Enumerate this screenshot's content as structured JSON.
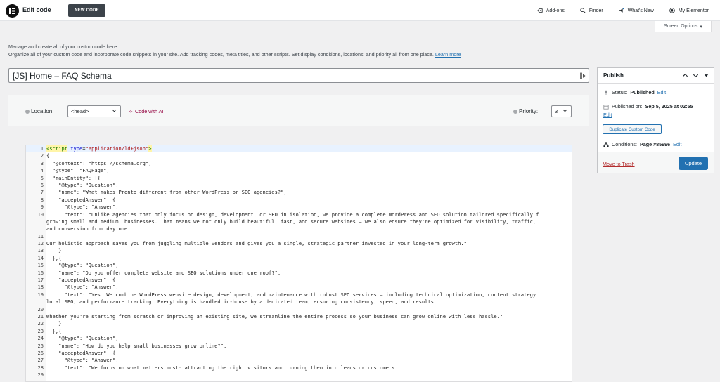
{
  "topbar": {
    "app_title": "Edit code",
    "new_code_label": "NEW CODE",
    "nav": {
      "addons": "Add-ons",
      "finder": "Finder",
      "whats_new": "What's New",
      "my_elementor": "My Elementor"
    }
  },
  "screen_options": "Screen Options",
  "intro": {
    "line1": "Manage and create all of your custom code here.",
    "line2": "Organize all of your custom code and incorporate code snippets in your site. Add tracking codes, meta titles, and other scripts. Set display conditions, locations, and priority all from one place.",
    "learn_more": "Learn more"
  },
  "code_title": "[JS] Home – FAQ Schema",
  "toolbar": {
    "location_label": "Location:",
    "location_value": "<head>",
    "ai_link": "Code with AI",
    "priority_label": "Priority:",
    "priority_value": "3"
  },
  "publish": {
    "title": "Publish",
    "status_label": "Status:",
    "status_value": "Published",
    "status_edit": "Edit",
    "published_label": "Published on:",
    "published_value": "Sep 5, 2025 at 02:55",
    "published_edit": "Edit",
    "duplicate_label": "Duplicate Custom Code",
    "conditions_label": "Conditions:",
    "conditions_value": "Page #85996",
    "conditions_edit": "Edit",
    "trash_label": "Move to Trash",
    "update_label": "Update"
  },
  "code_lines": [
    {
      "n": "1",
      "t": "<script type=\"application/ld+json\">"
    },
    {
      "n": "2",
      "t": "{"
    },
    {
      "n": "3",
      "t": "  \"@context\": \"https://schema.org\","
    },
    {
      "n": "4",
      "t": "  \"@type\": \"FAQPage\","
    },
    {
      "n": "5",
      "t": "  \"mainEntity\": [{"
    },
    {
      "n": "6",
      "t": "    \"@type\": \"Question\","
    },
    {
      "n": "7",
      "t": "    \"name\": \"What makes Pronto different from other WordPress or SEO agencies?\","
    },
    {
      "n": "8",
      "t": "    \"acceptedAnswer\": {"
    },
    {
      "n": "9",
      "t": "      \"@type\": \"Answer\","
    },
    {
      "n": "10",
      "t": "      \"text\": \"Unlike agencies that only focus on design, development, or SEO in isolation, we provide a complete WordPress and SEO solution tailored specifically f"
    },
    {
      "n": "",
      "t": "growing small and medium  businesses. That means we not only build beautiful, fast, and secure websites — we also ensure they're optimized for visibility, traffic,"
    },
    {
      "n": "",
      "t": "and conversion from day one."
    },
    {
      "n": "11",
      "t": ""
    },
    {
      "n": "12",
      "t": "Our holistic approach saves you from juggling multiple vendors and gives you a single, strategic partner invested in your long-term growth.\""
    },
    {
      "n": "13",
      "t": "    }"
    },
    {
      "n": "14",
      "t": "  },{"
    },
    {
      "n": "15",
      "t": "    \"@type\": \"Question\","
    },
    {
      "n": "16",
      "t": "    \"name\": \"Do you offer complete website and SEO solutions under one roof?\","
    },
    {
      "n": "17",
      "t": "    \"acceptedAnswer\": {"
    },
    {
      "n": "18",
      "t": "      \"@type\": \"Answer\","
    },
    {
      "n": "19",
      "t": "      \"text\": \"Yes. We combine WordPress website design, development, and maintenance with robust SEO services — including technical optimization, content strategy"
    },
    {
      "n": "",
      "t": "local SEO, and performance tracking. Everything is handled in-house by a dedicated team, ensuring consistency, speed, and results."
    },
    {
      "n": "20",
      "t": ""
    },
    {
      "n": "21",
      "t": "Whether you're starting from scratch or improving an existing site, we streamline the entire process so your business can grow online with less hassle.\""
    },
    {
      "n": "22",
      "t": "    }"
    },
    {
      "n": "23",
      "t": "  },{"
    },
    {
      "n": "24",
      "t": "    \"@type\": \"Question\","
    },
    {
      "n": "25",
      "t": "    \"name\": \"How do you help small businesses grow online?\","
    },
    {
      "n": "26",
      "t": "    \"acceptedAnswer\": {"
    },
    {
      "n": "27",
      "t": "      \"@type\": \"Answer\","
    },
    {
      "n": "28",
      "t": "      \"text\": \"We focus on what matters most: attracting the right visitors and turning them into leads or customers."
    },
    {
      "n": "29",
      "t": ""
    }
  ]
}
